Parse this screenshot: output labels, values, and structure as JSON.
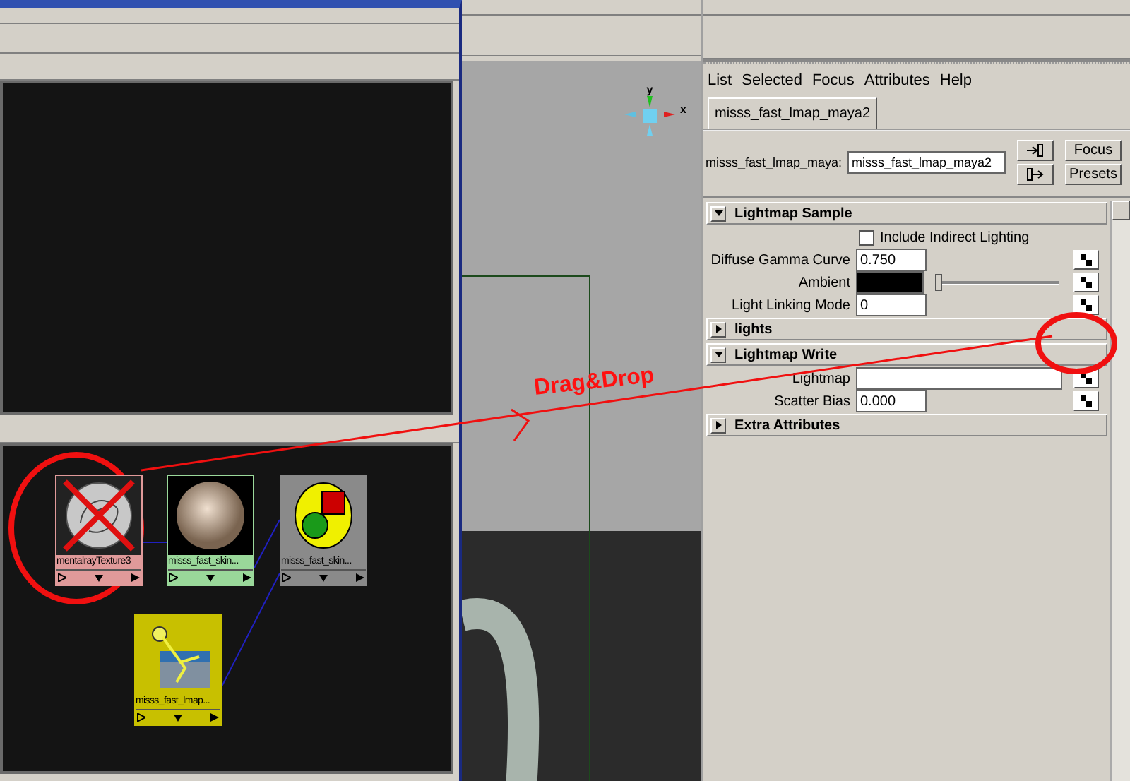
{
  "node_editor": {
    "nodes": [
      {
        "label": "mentalrayTexture3",
        "kind": "texture",
        "color": "#e09a9a"
      },
      {
        "label": "misss_fast_skin...",
        "kind": "sphere",
        "color": "#9ad89a"
      },
      {
        "label": "misss_fast_skin...",
        "kind": "shading",
        "color": "#8a8a8a"
      },
      {
        "label": "misss_fast_lmap...",
        "kind": "lightmap",
        "color": "#c8c000"
      }
    ]
  },
  "viewport": {
    "axis_labels": [
      "y",
      "x"
    ]
  },
  "attribute_editor": {
    "menu": [
      "List",
      "Selected",
      "Focus",
      "Attributes",
      "Help"
    ],
    "tabs": [
      {
        "label": "misss_fast_lmap_maya2",
        "selected": true
      }
    ],
    "node_name_label": "misss_fast_lmap_maya:",
    "node_name_value": "misss_fast_lmap_maya2",
    "buttons": [
      "Focus",
      "Presets"
    ],
    "sections": [
      {
        "title": "Lightmap Sample",
        "expanded": true,
        "rows": [
          {
            "kind": "checkbox",
            "label": "Include Indirect Lighting",
            "checked": false
          },
          {
            "kind": "field",
            "label": "Diffuse Gamma Curve",
            "value": "0.750"
          },
          {
            "kind": "color",
            "label": "Ambient",
            "level": 0
          },
          {
            "kind": "field",
            "label": "Light Linking Mode",
            "value": "0"
          }
        ]
      },
      {
        "title": "lights",
        "expanded": false
      },
      {
        "title": "Lightmap Write",
        "expanded": true,
        "rows": [
          {
            "kind": "wide",
            "label": "Lightmap"
          },
          {
            "kind": "field",
            "label": "Scatter Bias",
            "value": "0.000"
          }
        ]
      },
      {
        "title": "Extra Attributes",
        "expanded": false
      }
    ]
  },
  "annotation": {
    "text": "Drag&Drop"
  }
}
